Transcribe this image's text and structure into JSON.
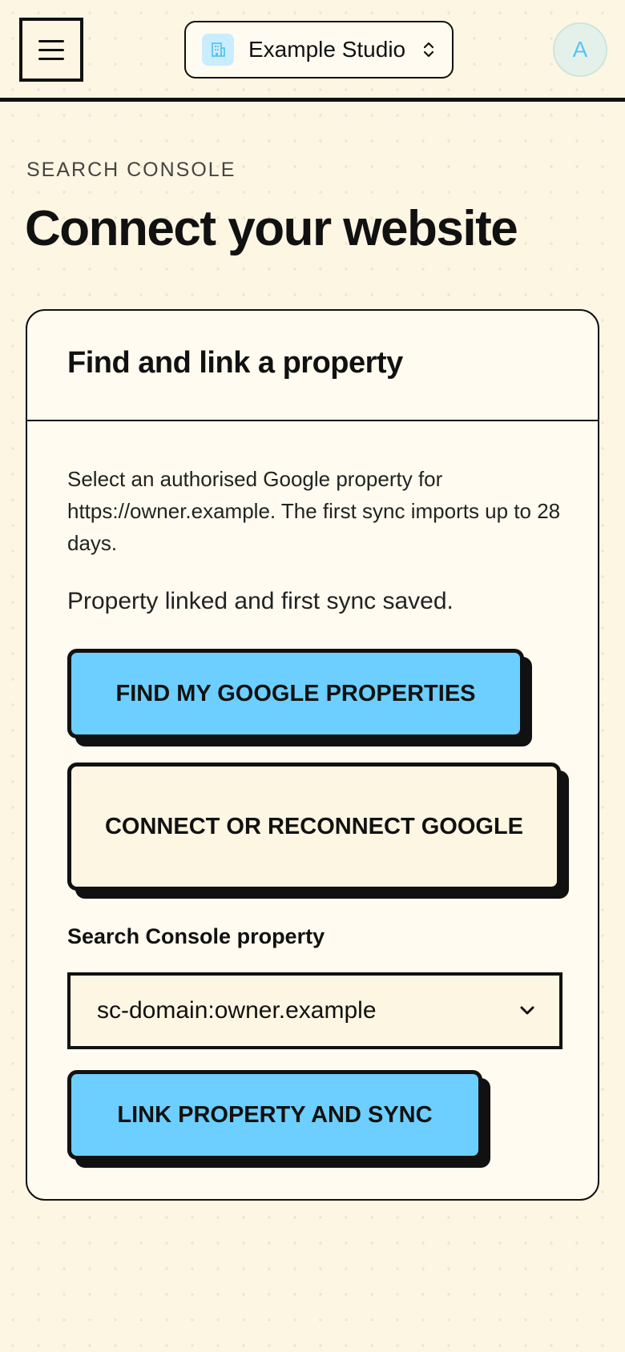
{
  "header": {
    "menu_icon": "hamburger-menu-icon",
    "workspace": {
      "icon": "building-icon",
      "name": "Example Studio",
      "chevron_icon": "chevron-up-down-icon"
    },
    "avatar_initial": "A"
  },
  "page": {
    "eyebrow": "SEARCH CONSOLE",
    "title": "Connect your website"
  },
  "card": {
    "title": "Find and link a property",
    "description": "Select an authorised Google property for https://owner.example. The first sync imports up to 28 days.",
    "status": "Property linked and first sync saved.",
    "find_button": "FIND MY GOOGLE PROPERTIES",
    "connect_button": "CONNECT OR RECONNECT GOOGLE",
    "property_label": "Search Console property",
    "property_select": {
      "selected": "sc-domain:owner.example",
      "chevron_icon": "chevron-down-icon"
    },
    "link_button": "LINK PROPERTY AND SYNC"
  },
  "colors": {
    "background": "#fdf6e3",
    "accent": "#6ccfff",
    "ink": "#111111"
  }
}
